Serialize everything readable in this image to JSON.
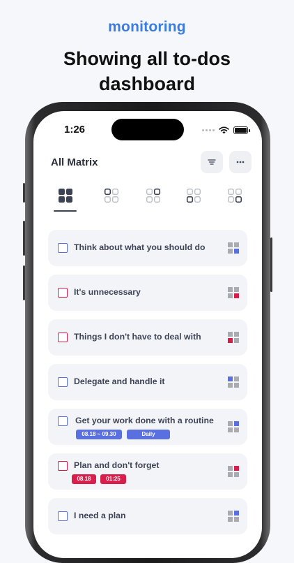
{
  "hero": {
    "kicker": "monitoring",
    "title_line1": "Showing all to-dos",
    "title_line2": "dashboard"
  },
  "status_bar": {
    "time": "1:26"
  },
  "header": {
    "title": "All Matrix",
    "filter_icon": "filter-lines-icon",
    "more_icon": "more-dots-icon"
  },
  "tabs": [
    {
      "name": "all-quadrants",
      "highlight": "all",
      "selected": true
    },
    {
      "name": "quadrant-1",
      "highlight": "top-left",
      "selected": false
    },
    {
      "name": "quadrant-2",
      "highlight": "top-right",
      "selected": false
    },
    {
      "name": "quadrant-3",
      "highlight": "bottom-left",
      "selected": false
    },
    {
      "name": "quadrant-4",
      "highlight": "bottom-right",
      "selected": false
    }
  ],
  "todos": [
    {
      "text": "Think about what you should do",
      "checkbox_color": "#5a6fd6",
      "quadrant": "bottom-right",
      "quadrant_color": "#5b70e0"
    },
    {
      "text": "It's unnecessary",
      "checkbox_color": "#d61e4c",
      "quadrant": "bottom-right",
      "quadrant_color": "#d61e4c"
    },
    {
      "text": "Things I don't have to deal with",
      "checkbox_color": "#d61e4c",
      "quadrant": "bottom-left",
      "quadrant_color": "#d61e4c"
    },
    {
      "text": "Delegate and handle it",
      "checkbox_color": "#5a6fd6",
      "quadrant": "top-left",
      "quadrant_color": "#5b70e0"
    },
    {
      "text": "Get your work done with a routine",
      "checkbox_color": "#5a6fd6",
      "quadrant": "top-right",
      "quadrant_color": "#5b70e0",
      "tags": [
        {
          "label": "08.18 ~ 09.30",
          "color": "blue"
        },
        {
          "label": "Daily",
          "color": "blue"
        }
      ]
    },
    {
      "text": "Plan and don't forget",
      "checkbox_color": "#d61e4c",
      "quadrant": "top-right",
      "quadrant_color": "#d61e4c",
      "tags": [
        {
          "label": "08.18",
          "color": "red"
        },
        {
          "label": "01:25",
          "color": "red"
        }
      ]
    },
    {
      "text": "I need a plan",
      "checkbox_color": "#5a6fd6",
      "quadrant": "top-right",
      "quadrant_color": "#5b70e0"
    }
  ],
  "colors": {
    "accent_blue": "#3b7ce0",
    "matrix_blue": "#5b70e0",
    "matrix_red": "#d61e4c",
    "matrix_gray": "#a9abb1"
  }
}
